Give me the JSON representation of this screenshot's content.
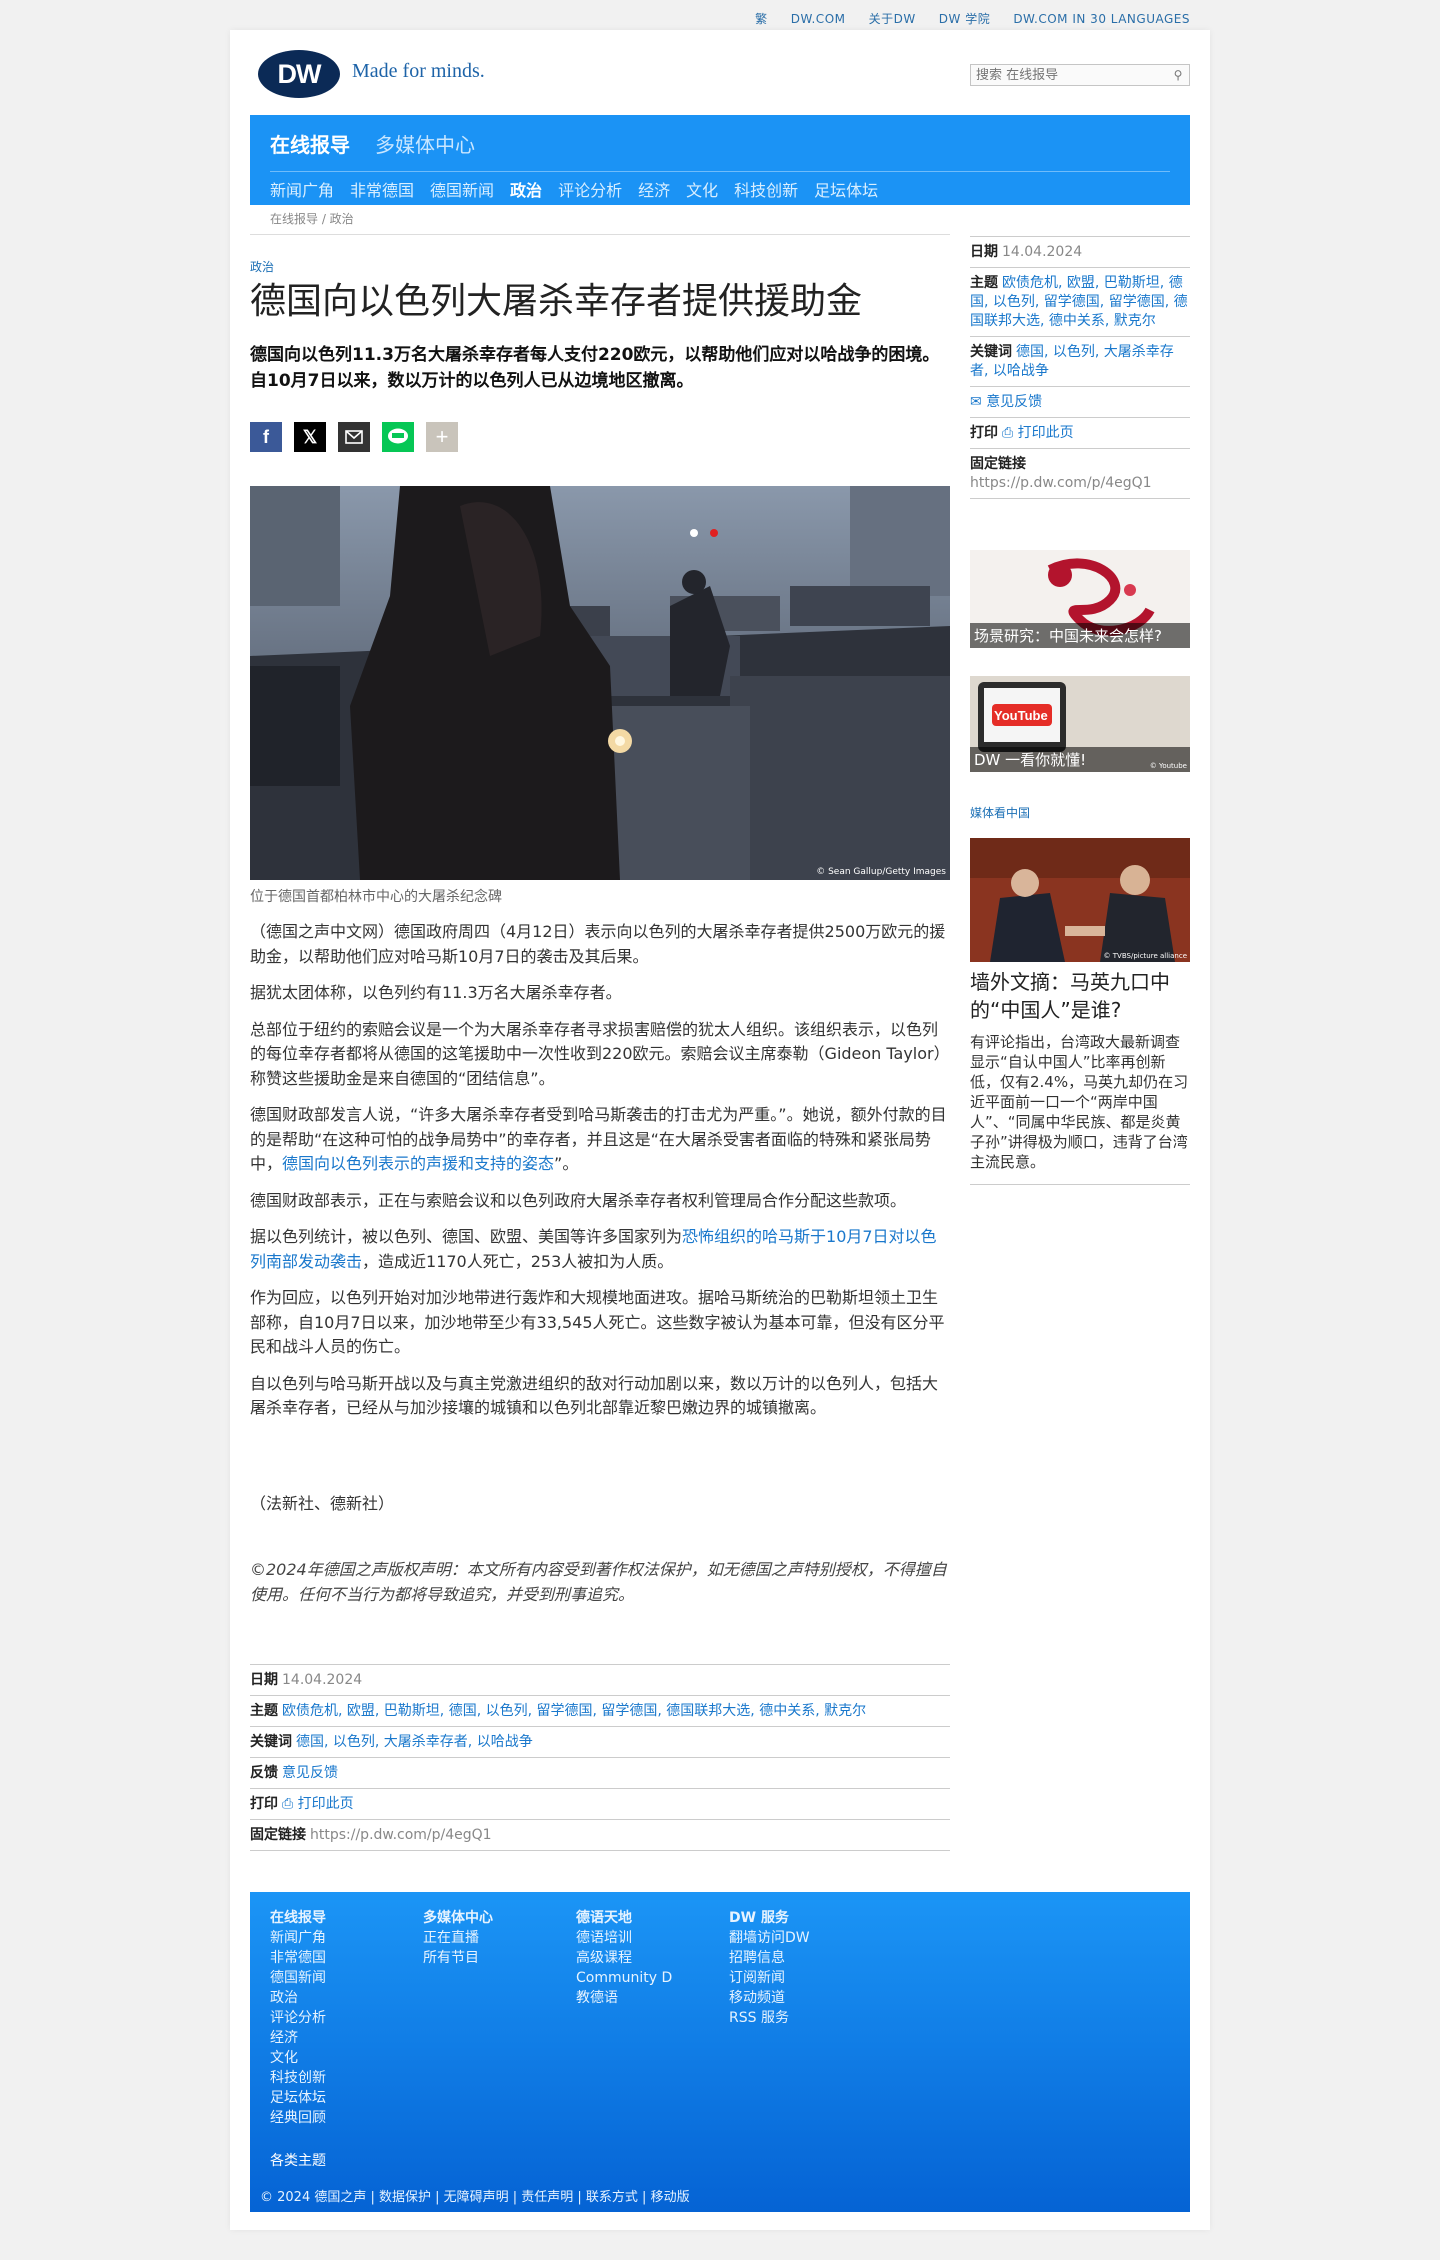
{
  "topnav": [
    "繁",
    "DW.COM",
    "关于DW",
    "DW 学院",
    "DW.COM IN 30 LANGUAGES"
  ],
  "brand": {
    "logo": "DW",
    "tagline": "Made for minds."
  },
  "search": {
    "placeholder": "搜索 在线报导"
  },
  "mainnav": {
    "active": "在线报导",
    "other": "多媒体中心"
  },
  "subnav": [
    "新闻广角",
    "非常德国",
    "德国新闻",
    "政治",
    "评论分析",
    "经济",
    "文化",
    "科技创新",
    "足坛体坛"
  ],
  "breadcrumb": "在线报导 / 政治",
  "article": {
    "kicker": "政治",
    "title": "德国向以色列大屠杀幸存者提供援助金",
    "lead": "德国向以色列11.3万名大屠杀幸存者每人支付220欧元，以帮助他们应对以哈战争的困境。自10月7日以来，数以万计的以色列人已从边境地区撤离。",
    "image_credit": "© Sean Gallup/Getty Images",
    "caption": "位于德国首都柏林市中心的大屠杀纪念碑",
    "p1": "（德国之声中文网）德国政府周四（4月12日）表示向以色列的大屠杀幸存者提供2500万欧元的援助金，以帮助他们应对哈马斯10月7日的袭击及其后果。",
    "p2": "据犹太团体称，以色列约有11.3万名大屠杀幸存者。",
    "p3": "总部位于纽约的索赔会议是一个为大屠杀幸存者寻求损害赔偿的犹太人组织。该组织表示，以色列的每位幸存者都将从德国的这笔援助中一次性收到220欧元。索赔会议主席泰勒（Gideon Taylor）称赞这些援助金是来自德国的“团结信息”。",
    "p4a": "德国财政部发言人说，“许多大屠杀幸存者受到哈马斯袭击的打击尤为严重。”。她说，额外付款的目的是帮助“在这种可怕的战争局势中”的幸存者，并且这是“在大屠杀受害者面临的特殊和紧张局势中，",
    "p4link": "德国向以色列表示的声援和支持的姿态",
    "p4b": "”。",
    "p5": "德国财政部表示，正在与索赔会议和以色列政府大屠杀幸存者权利管理局合作分配这些款项。",
    "p6a": "据以色列统计，被以色列、德国、欧盟、美国等许多国家列为",
    "p6link": "恐怖组织的哈马斯于10月7日对以色列南部发动袭击",
    "p6b": "，造成近1170人死亡，253人被扣为人质。",
    "p7": "作为回应，以色列开始对加沙地带进行轰炸和大规模地面进攻。据哈马斯统治的巴勒斯坦领土卫生部称，自10月7日以来，加沙地带至少有33,545人死亡。这些数字被认为基本可靠，但没有区分平民和战斗人员的伤亡。",
    "p8": "自以色列与哈马斯开战以及与真主党激进组织的敌对行动加剧以来，数以万计的以色列人，包括大屠杀幸存者，已经从与加沙接壤的城镇和以色列北部靠近黎巴嫩边界的城镇撤离。",
    "agency": "（法新社、德新社）",
    "copyright": "©2024年德国之声版权声明：本文所有内容受到著作权法保护，如无德国之声特别授权，不得擅自使用。任何不当行为都将导致追究，并受到刑事追究。"
  },
  "meta": {
    "date_label": "日期",
    "date": "14.04.2024",
    "topics_label": "主题",
    "topics": "欧债危机, 欧盟, 巴勒斯坦, 德国, 以色列, 留学德国, 留学德国, 德国联邦大选, 德中关系, 默克尔",
    "keywords_label": "关键词",
    "keywords": "德国, 以色列, 大屠杀幸存者, 以哈战争",
    "feedback_label": "反馈",
    "feedback": "意见反馈",
    "print_label": "打印",
    "print": "打印此页",
    "permalink_label": "固定链接",
    "permalink": "https://p.dw.com/p/4egQ1"
  },
  "sidebar": {
    "teaser1": "场景研究：中国未来会怎样?",
    "teaser2": "DW 一看你就懂!",
    "teaser2_logo": "YouTube",
    "teaser2_credit": "© Youtube",
    "section": "媒体看中国",
    "img_credit": "© TVBS/picture alliance",
    "title": "墙外文摘：马英九口中的“中国人”是谁?",
    "text": "有评论指出，台湾政大最新调查显示“自认中国人”比率再创新低，仅有2.4%，马英九却仍在习近平面前一口一个“两岸中国人”、“同属中华民族、都是炎黄子孙”讲得极为顺口，违背了台湾主流民意。"
  },
  "footer": {
    "col1": [
      "在线报导",
      "新闻广角",
      "非常德国",
      "德国新闻",
      "政治",
      "评论分析",
      "经济",
      "文化",
      "科技创新",
      "足坛体坛",
      "经典回顾"
    ],
    "col2": [
      "多媒体中心",
      "正在直播",
      "所有节目"
    ],
    "col3": [
      "德语天地",
      "德语培训",
      "高级课程",
      "Community D",
      "教德语"
    ],
    "col4": [
      "DW 服务",
      "翻墙访问DW",
      "招聘信息",
      "订阅新闻",
      "移动频道",
      "RSS 服务"
    ],
    "topics": "各类主题",
    "copyright": "© 2024 德国之声 | 数据保护 | 无障碍声明 | 责任声明 | 联系方式 | 移动版"
  },
  "colors": {
    "brand_blue": "#1b93f5",
    "link": "#1a78cc",
    "logo_navy": "#0b2a56"
  }
}
